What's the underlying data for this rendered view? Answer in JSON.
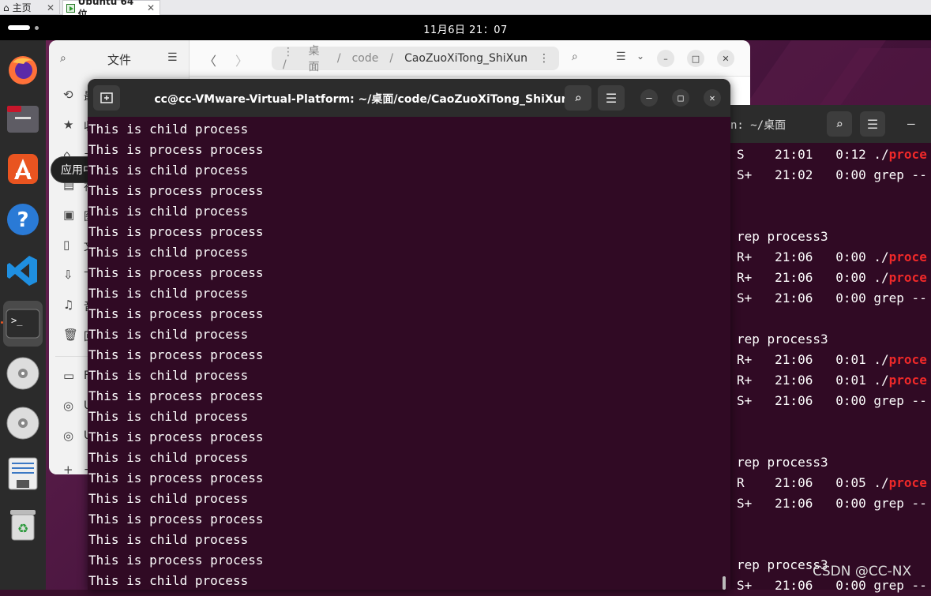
{
  "vm_tabs": {
    "home": "主页",
    "vm": "Ubuntu 64 位",
    "close": "✕"
  },
  "topbar": {
    "clock": "11月6日  21：07"
  },
  "dock": {
    "tooltip": "应用中心"
  },
  "files": {
    "title": "文件",
    "path": [
      "桌面",
      "code",
      "CaoZuoXiTong_ShiXun"
    ],
    "sidebar_chars": [
      "最",
      "收",
      "主",
      "视",
      "图",
      "文",
      "下",
      "音",
      "回",
      "F",
      "U",
      "U",
      "+"
    ]
  },
  "terminal_back": {
    "title": "n: ~/桌面",
    "lines": [
      {
        "text": "S    21:01   0:12 ./",
        "red": "proce"
      },
      {
        "text": "S+   21:02   0:00 grep --",
        "red": ""
      },
      {
        "text": "",
        "red": ""
      },
      {
        "text": "",
        "red": ""
      },
      {
        "text": "rep process3",
        "red": ""
      },
      {
        "text": "R+   21:06   0:00 ./",
        "red": "proce"
      },
      {
        "text": "R+   21:06   0:00 ./",
        "red": "proce"
      },
      {
        "text": "S+   21:06   0:00 grep --",
        "red": ""
      },
      {
        "text": "",
        "red": ""
      },
      {
        "text": "rep process3",
        "red": ""
      },
      {
        "text": "R+   21:06   0:01 ./",
        "red": "proce"
      },
      {
        "text": "R+   21:06   0:01 ./",
        "red": "proce"
      },
      {
        "text": "S+   21:06   0:00 grep --",
        "red": ""
      },
      {
        "text": "",
        "red": ""
      },
      {
        "text": "",
        "red": ""
      },
      {
        "text": "rep process3",
        "red": ""
      },
      {
        "text": "R    21:06   0:05 ./",
        "red": "proce"
      },
      {
        "text": "S+   21:06   0:00 grep --",
        "red": ""
      },
      {
        "text": "",
        "red": ""
      },
      {
        "text": "",
        "red": ""
      },
      {
        "text": "rep process3",
        "red": ""
      },
      {
        "text": "S+   21:06   0:00 grep --",
        "red": ""
      }
    ]
  },
  "terminal_front": {
    "title": "cc@cc-VMware-Virtual-Platform: ~/桌面/code/CaoZuoXiTong_ShiXun",
    "lines": [
      "This is child process",
      "This is process process",
      "This is child process",
      "This is process process",
      "This is child process",
      "This is process process",
      "This is child process",
      "This is process process",
      "This is child process",
      "This is process process",
      "This is child process",
      "This is process process",
      "This is child process",
      "This is process process",
      "This is child process",
      "This is process process",
      "This is child process",
      "This is process process",
      "This is child process",
      "This is process process",
      "This is child process",
      "This is process process",
      "This is child process"
    ]
  },
  "watermark": "CSDN @CC-NX"
}
